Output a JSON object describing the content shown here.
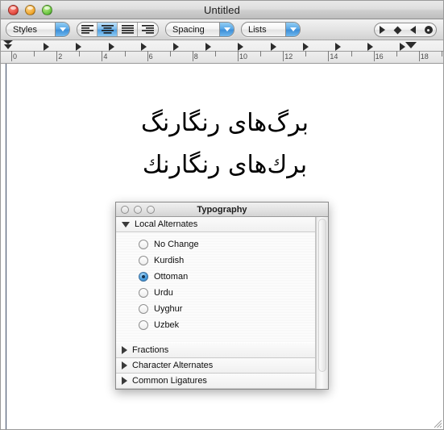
{
  "window": {
    "title": "Untitled",
    "traffic_lights": [
      {
        "name": "close",
        "color": "#e0463c"
      },
      {
        "name": "minimize",
        "color": "#efa427"
      },
      {
        "name": "zoom",
        "color": "#63c13c"
      }
    ]
  },
  "toolbar": {
    "styles_label": "Styles",
    "spacing_label": "Spacing",
    "lists_label": "Lists",
    "alignment": {
      "options": [
        "align-left",
        "align-center",
        "align-justify",
        "align-right"
      ],
      "selected": "align-center"
    },
    "nav_buttons": [
      "play-right-icon",
      "diamond-icon",
      "play-left-icon",
      "record-dot-icon"
    ]
  },
  "ruler": {
    "unit_labels": [
      "0",
      "2",
      "4",
      "6",
      "8",
      "10",
      "12",
      "14",
      "16",
      "18"
    ],
    "tab_stop_count": 12,
    "left_indent_marker": "left-indent-marker",
    "right_indent_marker": "right-indent-marker"
  },
  "document": {
    "lines": [
      "برگ‌های رنگارنگ",
      "برك‌هاى رنگارنك"
    ]
  },
  "typography_panel": {
    "title": "Typography",
    "traffic_lights": [
      "close",
      "minimize",
      "zoom"
    ],
    "sections": [
      {
        "label": "Local Alternates",
        "expanded": true,
        "options": [
          {
            "label": "No Change",
            "selected": false
          },
          {
            "label": "Kurdish",
            "selected": false
          },
          {
            "label": "Ottoman",
            "selected": true
          },
          {
            "label": "Urdu",
            "selected": false
          },
          {
            "label": "Uyghur",
            "selected": false
          },
          {
            "label": "Uzbek",
            "selected": false
          }
        ]
      },
      {
        "label": "Fractions",
        "expanded": false,
        "options": []
      },
      {
        "label": "Character Alternates",
        "expanded": false,
        "options": []
      },
      {
        "label": "Common Ligatures",
        "expanded": false,
        "options": []
      }
    ]
  },
  "colors": {
    "accent": "#4c9fe0",
    "selection": "#7cbcef",
    "window_chrome": "#e4e4e4",
    "panel_background": "#ececec"
  }
}
